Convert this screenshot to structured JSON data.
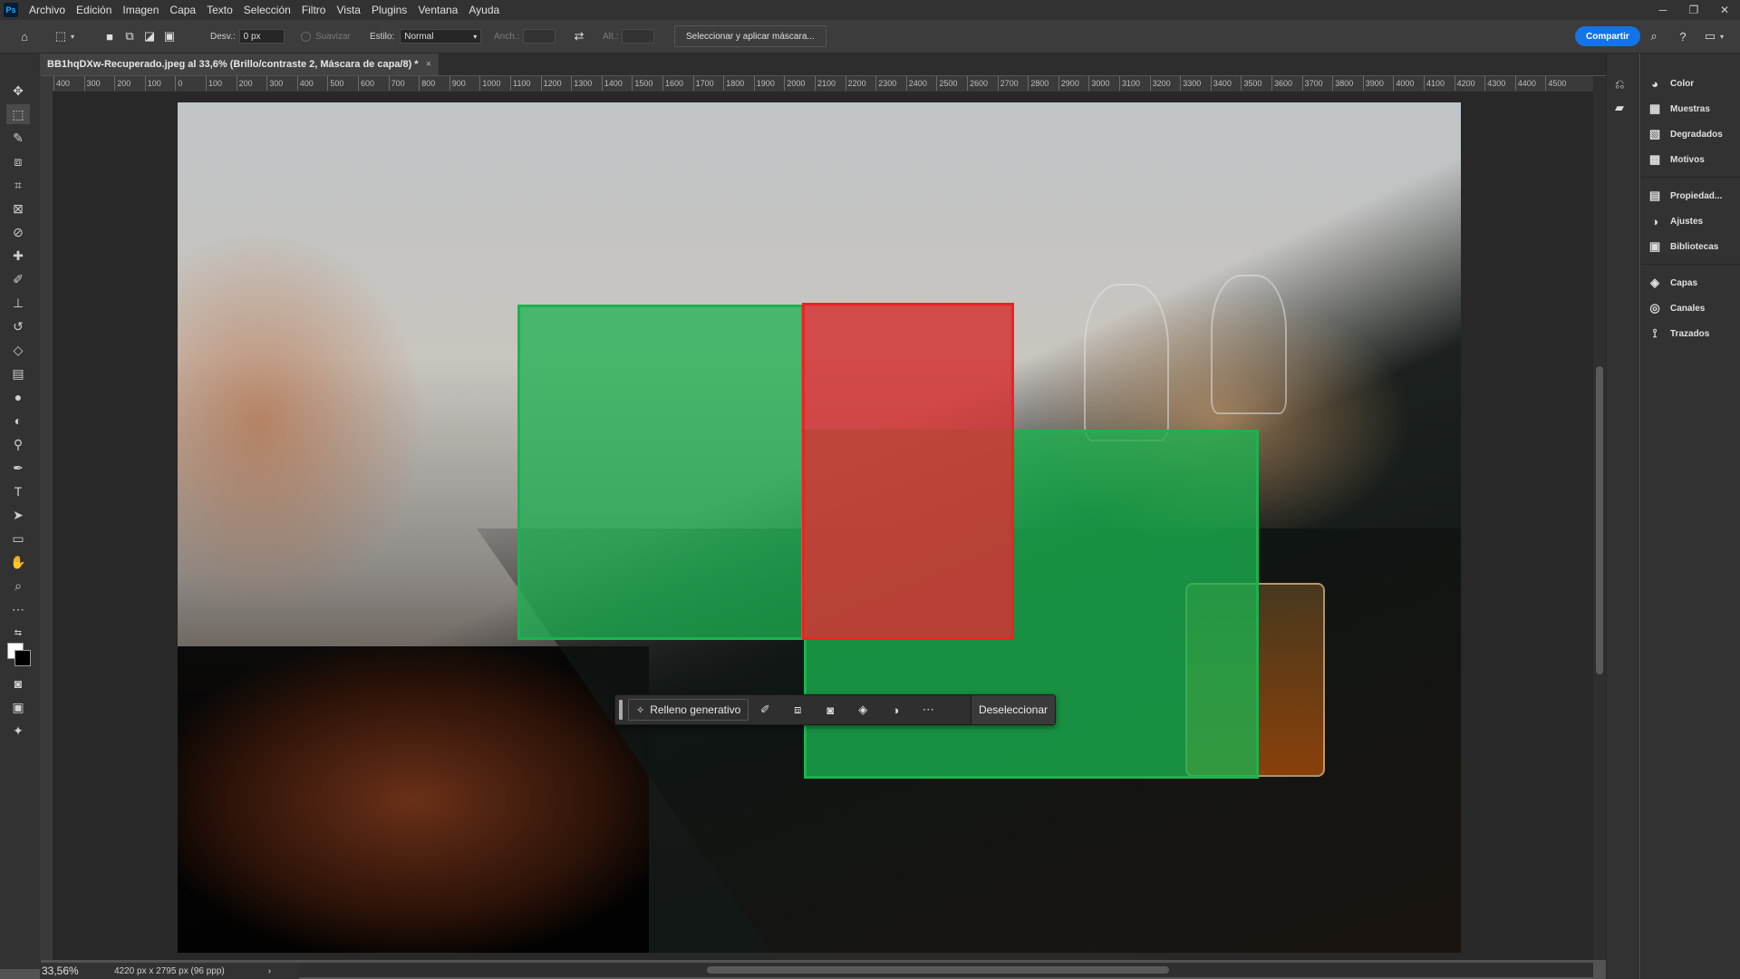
{
  "menu": [
    "Archivo",
    "Edición",
    "Imagen",
    "Capa",
    "Texto",
    "Selección",
    "Filtro",
    "Vista",
    "Plugins",
    "Ventana",
    "Ayuda"
  ],
  "app_logo": "Ps",
  "options": {
    "feather_label": "Desv.:",
    "feather_value": "0 px",
    "antialias_label": "Suavizar",
    "style_label": "Estilo:",
    "style_value": "Normal",
    "width_label": "Anch.:",
    "height_label": "Alt.:",
    "mask_button": "Seleccionar y aplicar máscara...",
    "share_button": "Compartir"
  },
  "document": {
    "tab_title": "BB1hqDXw-Recuperado.jpeg al 33,6% (Brillo/contraste 2, Máscara de capa/8) *",
    "close": "×"
  },
  "ruler_ticks": [
    "400",
    "300",
    "200",
    "100",
    "0",
    "100",
    "200",
    "300",
    "400",
    "500",
    "600",
    "700",
    "800",
    "900",
    "1000",
    "1100",
    "1200",
    "1300",
    "1400",
    "1500",
    "1600",
    "1700",
    "1800",
    "1900",
    "2000",
    "2100",
    "2200",
    "2300",
    "2400",
    "2500",
    "2600",
    "2700",
    "2800",
    "2900",
    "3000",
    "3100",
    "3200",
    "3300",
    "3400",
    "3500",
    "3600",
    "3700",
    "3800",
    "3900",
    "4000",
    "4100",
    "4200",
    "4300",
    "4400",
    "4500"
  ],
  "taskbar": {
    "generative_fill": "Relleno generativo",
    "deselect": "Deseleccionar"
  },
  "status": {
    "zoom": "33,56%",
    "doc_info": "4220 px x 2795 px (96 ppp)"
  },
  "panels": {
    "color": "Color",
    "swatches": "Muestras",
    "gradients": "Degradados",
    "patterns": "Motivos",
    "properties": "Propiedad...",
    "adjustments": "Ajustes",
    "libraries": "Bibliotecas",
    "layers": "Capas",
    "channels": "Canales",
    "paths": "Trazados"
  },
  "colors": {
    "accent": "#1473e6",
    "selection_green": "#1cb24f",
    "selection_red": "#ee2222"
  }
}
